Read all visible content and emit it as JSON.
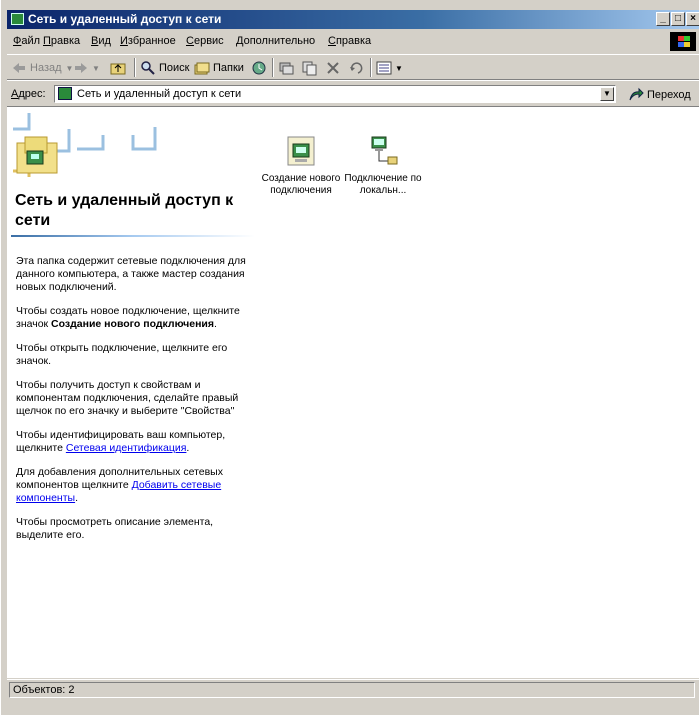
{
  "window": {
    "title": "Сеть и удаленный доступ к сети"
  },
  "title_buttons": {
    "minimize": "_",
    "maximize": "□",
    "close": "×"
  },
  "menubar": {
    "items": [
      "Файл",
      "Правка",
      "Вид",
      "Избранное",
      "Сервис",
      "Дополнительно",
      "Справка"
    ]
  },
  "toolbar": {
    "back": "Назад",
    "search": "Поиск",
    "folders": "Папки"
  },
  "address": {
    "label": "Адрес:",
    "value": "Сеть и удаленный доступ к сети",
    "go": "Переход"
  },
  "left_pane": {
    "title": "Сеть и удаленный доступ к сети",
    "p1": "Эта папка содержит сетевые подключения для данного компьютера, а также мастер создания новых подключений.",
    "p2_pre": "Чтобы создать новое подключение, щелкните значок ",
    "p2_bold": "Создание нового подключения",
    "p2_post": ".",
    "p3": "Чтобы открыть подключение, щелкните его значок.",
    "p4": "Чтобы получить доступ к свойствам и компонентам подключения, сделайте правый щелчок по его значку и выберите \"Свойства\"",
    "p5_pre": "Чтобы идентифицировать ваш компьютер, щелкните ",
    "p5_link": "Сетевая идентификация",
    "p5_post": ".",
    "p6_pre": "Для добавления дополнительных сетевых компонентов щелкните ",
    "p6_link": "Добавить сетевые компоненты",
    "p6_post": ".",
    "p7": "Чтобы просмотреть описание элемента, выделите его."
  },
  "files": [
    {
      "label": "Создание нового подключения",
      "icon": "new-connection-icon"
    },
    {
      "label": "Подключение по локальн...",
      "icon": "lan-connection-icon"
    }
  ],
  "status": {
    "text": "Объектов: 2"
  }
}
